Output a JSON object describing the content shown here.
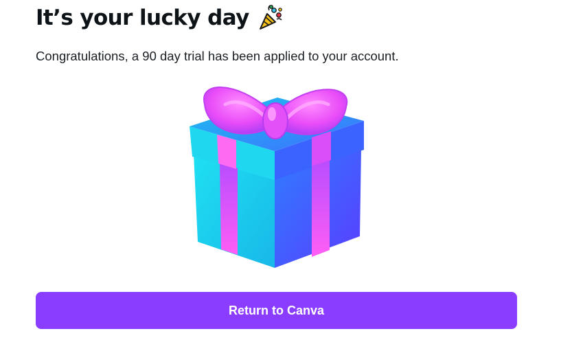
{
  "dialog": {
    "title": "It’s your lucky day",
    "title_icon": "party-popper-icon",
    "message": "Congratulations, a 90 day trial has been applied to your account.",
    "illustration": "gift-box-icon",
    "return_button_label": "Return to Canva"
  },
  "colors": {
    "button_bg": "#8b3dff",
    "button_text": "#ffffff",
    "title_text": "#0e1318",
    "gift_cyan": "#22c9ee",
    "gift_blue": "#3a52ff",
    "bow_pink": "#f062ff"
  }
}
